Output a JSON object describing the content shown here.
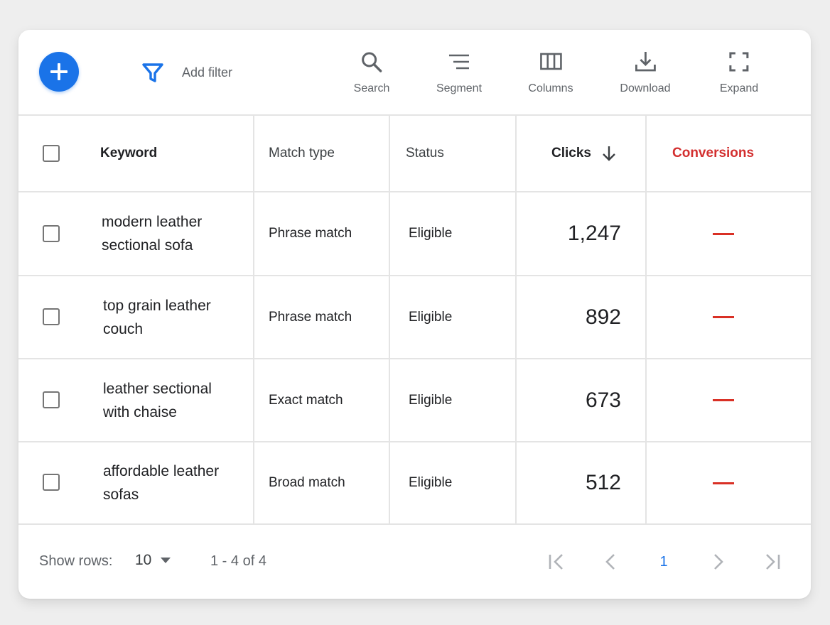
{
  "toolbar": {
    "add_label": "+",
    "filter_label": "Add filter",
    "tools": [
      {
        "label": "Search",
        "icon": "search-icon"
      },
      {
        "label": "Segment",
        "icon": "segment-icon"
      },
      {
        "label": "Columns",
        "icon": "columns-icon"
      },
      {
        "label": "Download",
        "icon": "download-icon"
      },
      {
        "label": "Expand",
        "icon": "expand-icon"
      }
    ]
  },
  "table": {
    "headers": {
      "keyword": "Keyword",
      "match_type": "Match type",
      "status": "Status",
      "clicks": "Clicks",
      "conversions": "Conversions"
    },
    "sort_icon": "arrow-down-icon",
    "rows": [
      {
        "keyword_line1": "modern leather",
        "keyword_line2": "sectional sofa",
        "match_type": "Phrase match",
        "status": "Eligible",
        "clicks": "1,247",
        "conversions": "—"
      },
      {
        "keyword_line1": "top grain leather",
        "keyword_line2": "couch",
        "match_type": "Phrase match",
        "status": "Eligible",
        "clicks": "892",
        "conversions": "—"
      },
      {
        "keyword_line1": "leather sectional",
        "keyword_line2": "with chaise",
        "match_type": "Exact match",
        "status": "Eligible",
        "clicks": "673",
        "conversions": "—"
      },
      {
        "keyword_line1": "affordable leather",
        "keyword_line2": "sofas",
        "match_type": "Broad match",
        "status": "Eligible",
        "clicks": "512",
        "conversions": "—"
      }
    ]
  },
  "footer": {
    "show_rows_label": "Show rows:",
    "rows_value": "10",
    "range_text": "1 - 4 of 4",
    "current_page": "1"
  },
  "colors": {
    "accent": "#1a73e8",
    "conversions": "#d32f2f"
  }
}
